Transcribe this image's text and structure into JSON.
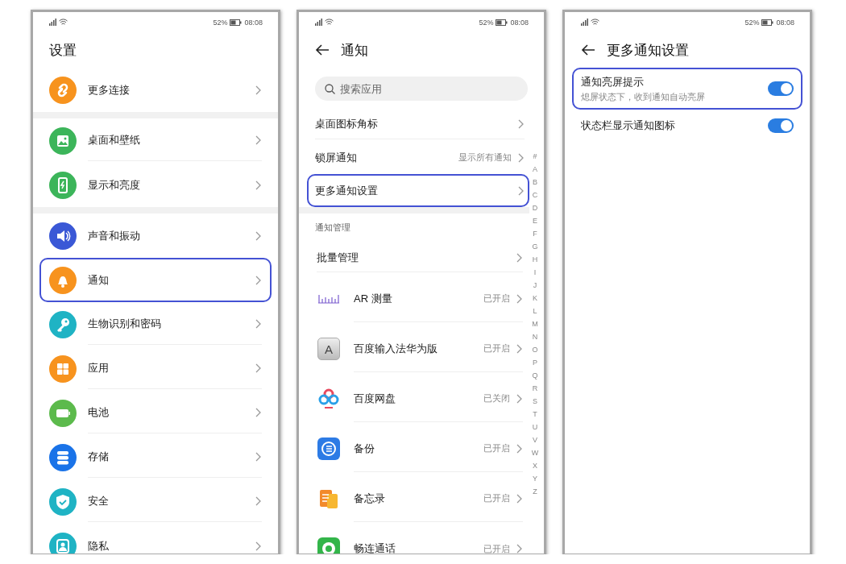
{
  "screens": [
    {
      "kind": "settings",
      "status": {
        "battery": "52%",
        "time": "08:08"
      },
      "title": "设置",
      "groups": [
        {
          "items": [
            {
              "label": "更多连接",
              "kind": "link",
              "color": "#f7931e",
              "highlighted": false
            }
          ]
        },
        {
          "items": [
            {
              "label": "桌面和壁纸",
              "kind": "image",
              "color": "#3cb55a",
              "highlighted": false
            },
            {
              "label": "显示和亮度",
              "kind": "phone",
              "color": "#3cb55a",
              "highlighted": false
            }
          ]
        },
        {
          "items": [
            {
              "label": "声音和振动",
              "kind": "sound",
              "color": "#3a58d6",
              "highlighted": false
            },
            {
              "label": "通知",
              "kind": "bell",
              "color": "#f7931e",
              "highlighted": true
            },
            {
              "label": "生物识别和密码",
              "kind": "key",
              "color": "#1fb3c4",
              "highlighted": false
            },
            {
              "label": "应用",
              "kind": "apps",
              "color": "#f7931e",
              "highlighted": false
            },
            {
              "label": "电池",
              "kind": "battery",
              "color": "#5cba4c",
              "highlighted": false
            },
            {
              "label": "存储",
              "kind": "storage",
              "color": "#1a73e8",
              "highlighted": false
            },
            {
              "label": "安全",
              "kind": "shield",
              "color": "#1fb3c4",
              "highlighted": false
            },
            {
              "label": "隐私",
              "kind": "person",
              "color": "#1fb3c4",
              "highlighted": false
            }
          ]
        }
      ]
    },
    {
      "kind": "notifications",
      "status": {
        "battery": "52%",
        "time": "08:08"
      },
      "title": "通知",
      "search": {
        "placeholder": "搜索应用"
      },
      "rows": [
        {
          "label": "桌面图标角标",
          "highlighted": false
        },
        {
          "label": "锁屏通知",
          "value": "显示所有通知",
          "highlighted": false
        },
        {
          "label": "更多通知设置",
          "highlighted": true
        }
      ],
      "section": "通知管理",
      "bulk": "批量管理",
      "apps": [
        {
          "label": "AR 测量",
          "status": "已开启",
          "kind": "ruler"
        },
        {
          "label": "百度输入法华为版",
          "status": "已开启",
          "kind": "letter",
          "icon_text": "A"
        },
        {
          "label": "百度网盘",
          "status": "已关闭",
          "kind": "cloud"
        },
        {
          "label": "备份",
          "status": "已开启",
          "kind": "backup"
        },
        {
          "label": "备忘录",
          "status": "已开启",
          "kind": "notes"
        },
        {
          "label": "畅连通话",
          "status": "已开启",
          "kind": "chat"
        }
      ],
      "index_bar": [
        "#",
        "A",
        "B",
        "C",
        "D",
        "E",
        "F",
        "G",
        "H",
        "I",
        "J",
        "K",
        "L",
        "M",
        "N",
        "O",
        "P",
        "Q",
        "R",
        "S",
        "T",
        "U",
        "V",
        "W",
        "X",
        "Y",
        "Z"
      ]
    },
    {
      "kind": "more",
      "status": {
        "battery": "52%",
        "time": "08:08"
      },
      "title": "更多通知设置",
      "toggles": [
        {
          "label": "通知亮屏提示",
          "subtitle": "熄屏状态下，收到通知自动亮屏",
          "on": true,
          "highlighted": true
        },
        {
          "label": "状态栏显示通知图标",
          "on": true,
          "highlighted": false
        }
      ]
    }
  ]
}
